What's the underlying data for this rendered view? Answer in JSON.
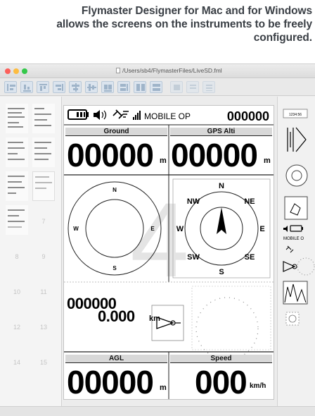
{
  "caption": {
    "line1": "Flymaster Designer for Mac and for Windows",
    "line2": "allows the screens on the instruments to be freely",
    "line3": "configured."
  },
  "window": {
    "path": "/Users/sb4/FlymasterFiles/LiveSD.fml"
  },
  "pages": [
    "7",
    "8",
    "9",
    "10",
    "11",
    "12",
    "13",
    "14",
    "15"
  ],
  "device": {
    "status_text": "MOBILE OP",
    "status_value": "000000",
    "watermark": "4",
    "ground": {
      "label": "Ground",
      "value": "00000",
      "unit": "m"
    },
    "gps_alti": {
      "label": "GPS Alti",
      "value": "00000",
      "unit": "m"
    },
    "compass_left": {
      "n": "N",
      "e": "E",
      "s": "S",
      "w": "W"
    },
    "compass_right": {
      "n": "N",
      "ne": "NE",
      "e": "E",
      "se": "SE",
      "s": "S",
      "sw": "SW",
      "w": "W",
      "nw": "NW"
    },
    "distance": {
      "value": "000000",
      "km_value": "0.000",
      "unit": "km"
    },
    "agl": {
      "label": "AGL",
      "value": "00000",
      "unit": "m"
    },
    "speed": {
      "label": "Speed",
      "value": "000",
      "unit": "km/h"
    }
  },
  "palette": {
    "small_label": "1234:56",
    "mobile_text": "MOBILE O"
  },
  "colors": {
    "close": "#fc605b",
    "minimize": "#fdbc40",
    "zoom": "#34c84a",
    "caption": "#3a3f45"
  }
}
